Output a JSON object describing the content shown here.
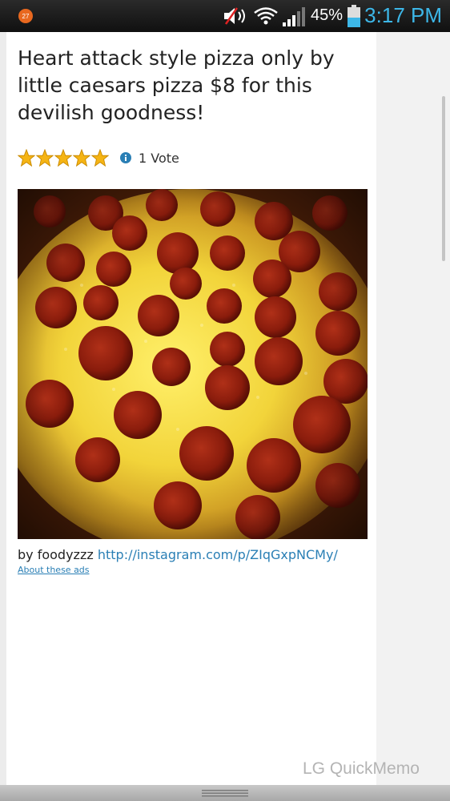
{
  "status_bar": {
    "notification_count": "27",
    "battery_percent": "45%",
    "time": "3:17 PM",
    "accent_color": "#3db7e8"
  },
  "post": {
    "title": "Heart attack style pizza only by little caesars pizza $8 for this devilish goodness!",
    "rating": {
      "stars": 5,
      "max_stars": 5,
      "votes_label": "1 Vote"
    },
    "byline_prefix": "by foodyzzz",
    "link_text": "http://instagram.com/p/ZIqGxpNCMy/",
    "about_ads": "About these ads"
  },
  "watermark": "LG QuickMemo",
  "icons": [
    "notification-icon",
    "volume-muted-icon",
    "wifi-icon",
    "signal-icon",
    "battery-icon",
    "star-icon",
    "info-icon",
    "drag-handle-icon"
  ]
}
